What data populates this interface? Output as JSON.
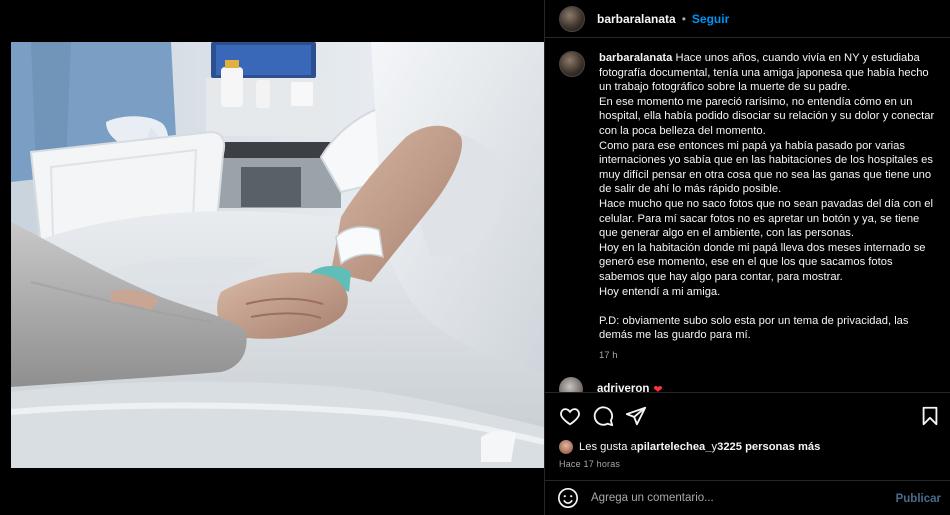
{
  "post": {
    "username": "barbaralanata",
    "dot": "•",
    "follow_label": "Seguir",
    "caption_user": "barbaralanata",
    "caption_paragraphs": [
      "Hace unos años, cuando vivía en NY y estudiaba fotografía documental, tenía una amiga japonesa que había hecho un trabajo fotográfico sobre la muerte de su padre.",
      "En ese momento me pareció rarísimo, no entendía cómo en un hospital, ella había podido disociar su relación y su dolor y conectar con la poca belleza del momento.",
      "Como para ese entonces mi papá ya había pasado por varias internaciones yo sabía que en las habitaciones de los hospitales es muy difícil pensar en otra cosa que no sea las ganas que tiene uno de salir de ahí lo más rápido posible.",
      "Hace mucho que no saco fotos que no sean pavadas del día con el celular. Para mí sacar fotos no es apretar un botón y ya, se tiene que generar algo en el ambiente, con las personas.",
      "Hoy en la habitación donde mi papá lleva dos meses internado se generó ese momento, ese en el que los que sacamos fotos sabemos que hay algo para contar, para mostrar.",
      "Hoy entendí a mi amiga.",
      "P.D: obviamente subo solo esta por un tema de privacidad, las demás me las guardo para mí."
    ],
    "caption_time": "17 h",
    "first_comment_user": "adriveron",
    "first_comment_emoji": "❤"
  },
  "engagement": {
    "likes_prefix": "Les gusta a ",
    "likes_user": "pilartelechea_",
    "likes_connector": " y ",
    "likes_count": "3225 personas más",
    "time_ago": "Hace 17 horas"
  },
  "comment_box": {
    "placeholder": "Agrega un comentario...",
    "publish_label": "Publicar"
  },
  "icons": {
    "like": "heart-icon",
    "comment": "comment-icon",
    "share": "share-icon",
    "save": "bookmark-icon",
    "emoji": "emoji-icon"
  },
  "colors": {
    "background": "#000000",
    "link_blue": "#0095f6",
    "muted_text": "#a8a8a8",
    "divider": "#262626"
  }
}
